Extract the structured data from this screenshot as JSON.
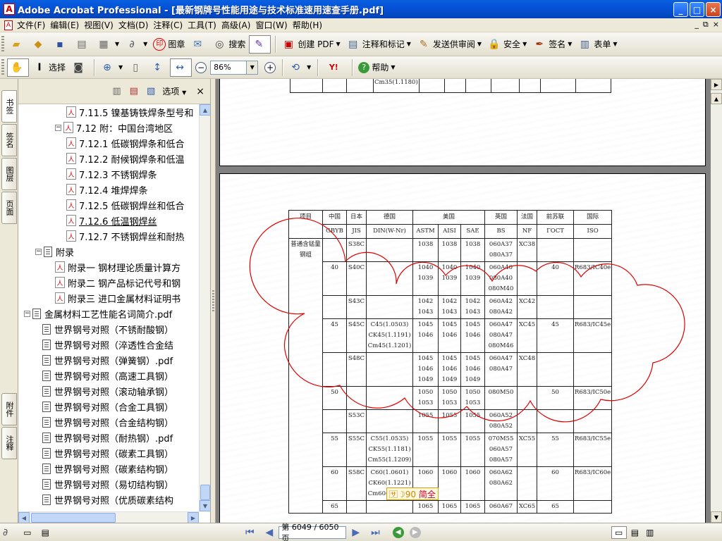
{
  "titlebar": {
    "app_name": "Adobe Acrobat Professional",
    "doc_title": " - [最新钢牌号性能用途与技术标准速用速查手册.pdf]",
    "app_icon": "acrobat-icon",
    "minimize": "_",
    "maximize": "□",
    "close": "×"
  },
  "menubar": {
    "items": [
      "文件(F)",
      "编辑(E)",
      "视图(V)",
      "文档(D)",
      "注释(C)",
      "工具(T)",
      "高级(A)",
      "窗口(W)",
      "帮助(H)"
    ],
    "mdi_minimize": "_",
    "mdi_restore": "⧉",
    "mdi_close": "×"
  },
  "toolbar1": {
    "stamp": "图章",
    "search": "搜索",
    "create_pdf": "创建 PDF",
    "comment": "注释和标记",
    "review": "发送供审阅",
    "security": "安全",
    "sign": "签名",
    "forms": "表单"
  },
  "toolbar2": {
    "select": "选择",
    "zoom": "86%",
    "help": "帮助"
  },
  "side_tabs": [
    "书签",
    "签名",
    "图层",
    "页面",
    "附件",
    "注释"
  ],
  "nav": {
    "options": "选项",
    "close": "×",
    "tree": [
      {
        "label": "7.11.5 镍基铸铁焊条型号和",
        "type": "bookmark"
      },
      {
        "label": "7.12 附：中国台湾地区",
        "type": "bookmark-expanded"
      },
      {
        "label": "7.12.1 低碳钢焊条和低合",
        "type": "bookmark"
      },
      {
        "label": "7.12.2 耐候钢焊条和低温",
        "type": "bookmark"
      },
      {
        "label": "7.12.3 不锈钢焊条",
        "type": "bookmark"
      },
      {
        "label": "7.12.4 堆焊焊条",
        "type": "bookmark"
      },
      {
        "label": "7.12.5 低碳钢焊丝和低合",
        "type": "bookmark"
      },
      {
        "label": "7.12.6 低温钢焊丝",
        "type": "bookmark-current"
      },
      {
        "label": "7.12.7 不锈钢焊丝和耐热",
        "type": "bookmark"
      },
      {
        "label": "附录",
        "type": "doc-expanded"
      },
      {
        "label": "附录一 钢材理论质量计算方",
        "type": "bookmark"
      },
      {
        "label": "附录二 钢产品标记代号和钢",
        "type": "bookmark"
      },
      {
        "label": "附录三 进口金属材料证明书",
        "type": "bookmark"
      },
      {
        "label": "金属材料工艺性能名词简介.pdf",
        "type": "doc-expanded"
      },
      {
        "label": "世界钢号对照（不锈耐酸钢）",
        "type": "doc"
      },
      {
        "label": "世界钢号对照（淬透性合金结",
        "type": "doc"
      },
      {
        "label": "世界钢号对照（弹簧钢）.pdf",
        "type": "doc"
      },
      {
        "label": "世界钢号对照（高速工具钢）",
        "type": "doc"
      },
      {
        "label": "世界钢号对照（滚动轴承钢）",
        "type": "doc"
      },
      {
        "label": "世界钢号对照（合金工具钢）",
        "type": "doc"
      },
      {
        "label": "世界钢号对照（合金结构钢）",
        "type": "doc"
      },
      {
        "label": "世界钢号对照（耐热钢）.pdf",
        "type": "doc"
      },
      {
        "label": "世界钢号对照（碳素工具钢）",
        "type": "doc"
      },
      {
        "label": "世界钢号对照（碳素结构钢）",
        "type": "doc"
      },
      {
        "label": "世界钢号对照（易切结构钢）",
        "type": "doc"
      },
      {
        "label": "世界钢号对照（优质碳素结构",
        "type": "doc"
      }
    ]
  },
  "document": {
    "top_fragment": "Cm35(1.1180)",
    "header_row1": [
      "项目",
      "中国",
      "日本",
      "德国",
      "美国",
      "英国",
      "法国",
      "前苏联",
      "国际"
    ],
    "header_row2": [
      "GBYB",
      "JIS",
      "DIN(W-Nr)",
      "ASTM",
      "AISI",
      "SAE",
      "BS",
      "NF",
      "ГОСТ",
      "ISO"
    ],
    "category_label": "普通含锰量钢组",
    "rows": [
      {
        "cn": "",
        "jis": "S38C",
        "din": "",
        "astm": "1038",
        "aisi": "1038",
        "sae": "1038",
        "bs": "060A37\n080A37",
        "nf": "XC38",
        "gost": "",
        "iso": ""
      },
      {
        "cn": "40",
        "jis": "S40C",
        "din": "",
        "astm": "1040\n1039",
        "aisi": "1040\n1039",
        "sae": "1040\n1039",
        "bs": "060A40\n080A40\n080M40",
        "nf": "",
        "gost": "40",
        "iso": "R683/IC40e"
      },
      {
        "cn": "",
        "jis": "S43C",
        "din": "",
        "astm": "1042\n1043",
        "aisi": "1042\n1043",
        "sae": "1042\n1043",
        "bs": "060A42\n080A42",
        "nf": "XC42",
        "gost": "",
        "iso": ""
      },
      {
        "cn": "45",
        "jis": "S45C",
        "din": "C45(1.0503)\nCK45(1.1191)\nCm45(1.1201)",
        "astm": "1045\n1046",
        "aisi": "1045\n1046",
        "sae": "1045\n1046",
        "bs": "060A47\n080A47\n080M46",
        "nf": "XC45",
        "gost": "45",
        "iso": "R683/IC45e"
      },
      {
        "cn": "",
        "jis": "S48C",
        "din": "",
        "astm": "1045\n1046\n1049",
        "aisi": "1045\n1046\n1049",
        "sae": "1045\n1046\n1049",
        "bs": "060A47\n080A47",
        "nf": "XC48",
        "gost": "",
        "iso": ""
      },
      {
        "cn": "50",
        "jis": "",
        "din": "",
        "astm": "1050\n1053",
        "aisi": "1050\n1053",
        "sae": "1050\n1053",
        "bs": "080M50",
        "nf": "",
        "gost": "50",
        "iso": "R683/IC50e"
      },
      {
        "cn": "",
        "jis": "S53C",
        "din": "",
        "astm": "1055",
        "aisi": "1055",
        "sae": "1055",
        "bs": "060A52\n080A52",
        "nf": "",
        "gost": "",
        "iso": ""
      },
      {
        "cn": "55",
        "jis": "S55C",
        "din": "C55(1.0535)\nCK55(1.1181)\nCm55(1.1209)",
        "astm": "1055",
        "aisi": "1055",
        "sae": "1055",
        "bs": "070M55\n060A57\n080A57",
        "nf": "XC55",
        "gost": "55",
        "iso": "R683/IC55e"
      },
      {
        "cn": "60",
        "jis": "S58C",
        "din": "C60(1.0601)\nCK60(1.1221)\nCm60(1.1223)",
        "astm": "1060",
        "aisi": "1060",
        "sae": "1060",
        "bs": "060A62\n080A62",
        "nf": "",
        "gost": "60",
        "iso": "R683/IC60e"
      },
      {
        "cn": "65",
        "jis": "",
        "din": "",
        "astm": "1065",
        "aisi": "1065",
        "sae": "1065",
        "bs": "060A67",
        "nf": "XC65",
        "gost": "65",
        "iso": ""
      }
    ]
  },
  "ime": {
    "text": "简全",
    "glyphs": "🈂☽90"
  },
  "statusbar": {
    "page_display": "第 6049 / 6050 页",
    "first": "first-page-icon",
    "prev": "prev-page-icon",
    "next": "next-page-icon",
    "last": "last-page-icon"
  },
  "colors": {
    "titlebar": "#0452d6",
    "annotation": "#e00000",
    "doc_bg": "#808080"
  }
}
